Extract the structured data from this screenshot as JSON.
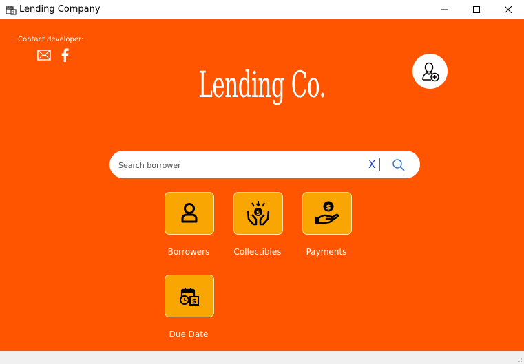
{
  "window": {
    "title": "Lending Company",
    "app_icon": "calendar-money-icon",
    "controls": [
      "minimize-icon",
      "maximize-icon",
      "close-icon"
    ]
  },
  "header": {
    "contact_label": "Contact developer:",
    "contact_icons": [
      "mail-icon",
      "facebook-icon"
    ],
    "brand": "Lending Co.",
    "add_user_icon": "add-user-icon"
  },
  "search": {
    "placeholder": "Search borrower",
    "value": "",
    "clear_label": "X"
  },
  "tiles": [
    {
      "label": "Borrowers",
      "icon": "person-icon"
    },
    {
      "label": "Collectibles",
      "icon": "hands-coin-icon"
    },
    {
      "label": "Payments",
      "icon": "hand-coin-icon"
    },
    {
      "label": "Due Date",
      "icon": "calendar-due-icon"
    }
  ],
  "colors": {
    "background": "#FF5500",
    "tile": "#F9A602",
    "text": "#FFFFFF",
    "clear": "#1A3FD8"
  }
}
